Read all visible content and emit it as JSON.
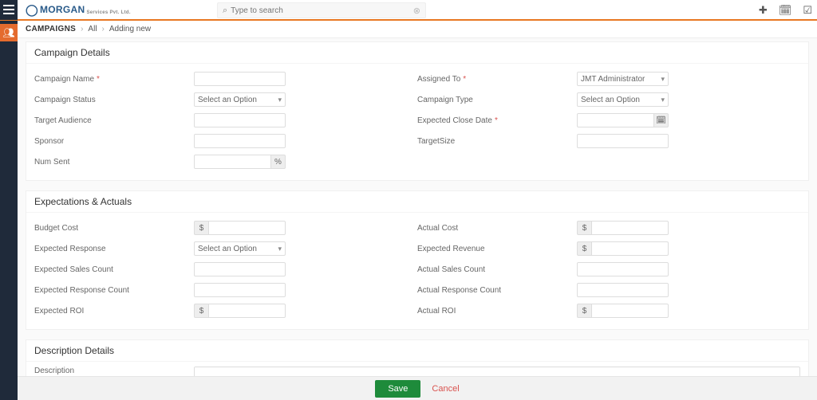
{
  "topbar": {
    "logo": {
      "brand": "MORGAN",
      "sub": "Services Pvt. Ltd."
    },
    "search": {
      "placeholder": "Type to search"
    }
  },
  "breadcrumb": {
    "root": "CAMPAIGNS",
    "all": "All",
    "current": "Adding new"
  },
  "sections": {
    "campaign_details": "Campaign Details",
    "expectations": "Expectations & Actuals",
    "description_details": "Description Details"
  },
  "fields": {
    "campaign_name": "Campaign Name",
    "assigned_to": "Assigned To",
    "campaign_status": "Campaign Status",
    "campaign_type": "Campaign Type",
    "target_audience": "Target Audience",
    "expected_close_date": "Expected Close Date",
    "sponsor": "Sponsor",
    "target_size": "TargetSize",
    "num_sent": "Num Sent",
    "budget_cost": "Budget Cost",
    "actual_cost": "Actual Cost",
    "expected_response": "Expected Response",
    "expected_revenue": "Expected Revenue",
    "expected_sales_count": "Expected Sales Count",
    "actual_sales_count": "Actual Sales Count",
    "expected_response_count": "Expected Response Count",
    "actual_response_count": "Actual Response Count",
    "expected_roi": "Expected ROI",
    "actual_roi": "Actual ROI",
    "description": "Description"
  },
  "selects": {
    "select_option": "Select an Option",
    "assigned_to_value": "JMT Administrator"
  },
  "symbols": {
    "currency": "$",
    "percent": "%"
  },
  "actions": {
    "save": "Save",
    "cancel": "Cancel"
  }
}
